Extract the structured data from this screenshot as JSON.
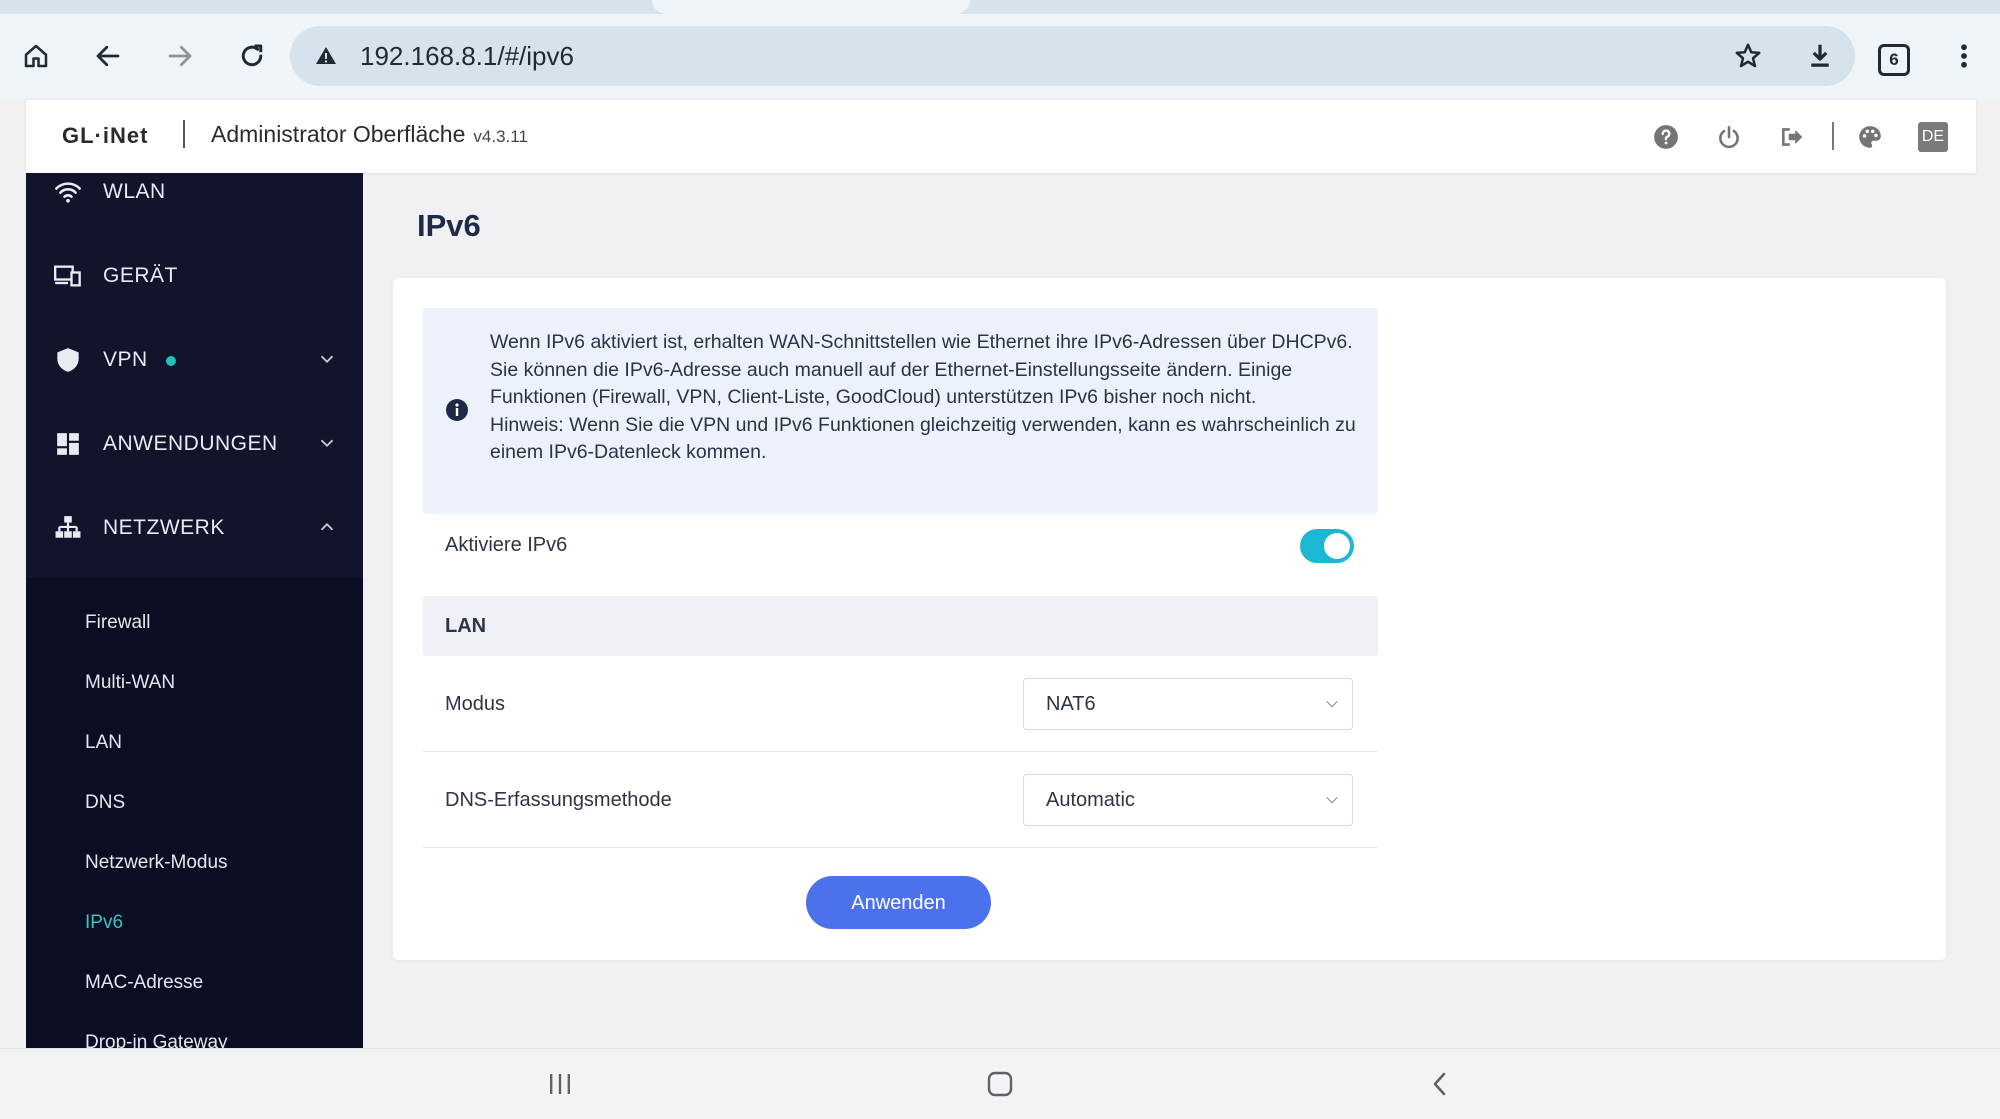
{
  "browser": {
    "url": "192.168.8.1/#/ipv6",
    "tab_count": "6",
    "icons": [
      "home-icon",
      "back-icon",
      "forward-icon",
      "reload-icon",
      "warning-icon",
      "star-icon",
      "download-icon",
      "tab-switcher-icon",
      "menu-icon"
    ]
  },
  "header": {
    "logo": "GL·iNet",
    "title": "Administrator Oberfläche",
    "version": "v4.3.11",
    "language": "DE",
    "icons": [
      "help-icon",
      "power-icon",
      "logout-icon",
      "theme-icon"
    ]
  },
  "sidebar": {
    "items": [
      {
        "label": "WLAN",
        "icon": "wifi-icon"
      },
      {
        "label": "GERÄT",
        "icon": "devices-icon"
      },
      {
        "label": "VPN",
        "icon": "shield-icon",
        "status_color": "#21c3b8",
        "expanded": false
      },
      {
        "label": "ANWENDUNGEN",
        "icon": "apps-icon",
        "expanded": false
      },
      {
        "label": "NETZWERK",
        "icon": "network-icon",
        "expanded": true
      }
    ],
    "submenu": [
      {
        "label": "Firewall"
      },
      {
        "label": "Multi-WAN"
      },
      {
        "label": "LAN"
      },
      {
        "label": "DNS"
      },
      {
        "label": "Netzwerk-Modus"
      },
      {
        "label": "IPv6",
        "active": true
      },
      {
        "label": "MAC-Adresse"
      },
      {
        "label": "Drop-in Gateway"
      }
    ]
  },
  "main": {
    "title": "IPv6",
    "info": {
      "line1": "Wenn IPv6 aktiviert ist, erhalten WAN-Schnittstellen wie Ethernet ihre IPv6-Adressen über DHCPv6. Sie können die IPv6-Adresse auch manuell auf der Ethernet-Einstellungsseite ändern. Einige Funktionen (Firewall, VPN, Client-Liste, GoodCloud) unterstützen IPv6 bisher noch nicht.",
      "line2": "Hinweis: Wenn Sie die VPN und IPv6 Funktionen gleichzeitig verwenden, kann es wahrscheinlich zu einem IPv6-Datenleck kommen."
    },
    "enable_label": "Aktiviere IPv6",
    "enable_value": true,
    "lan_section": "LAN",
    "mode_label": "Modus",
    "mode_value": "NAT6",
    "dns_label": "DNS-Erfassungsmethode",
    "dns_value": "Automatic",
    "apply_label": "Anwenden"
  },
  "colors": {
    "accent": "#4b72ec",
    "toggle_on": "#1cb7d2",
    "sidebar_bg": "#11142b",
    "active_submenu": "#38c7c0"
  }
}
